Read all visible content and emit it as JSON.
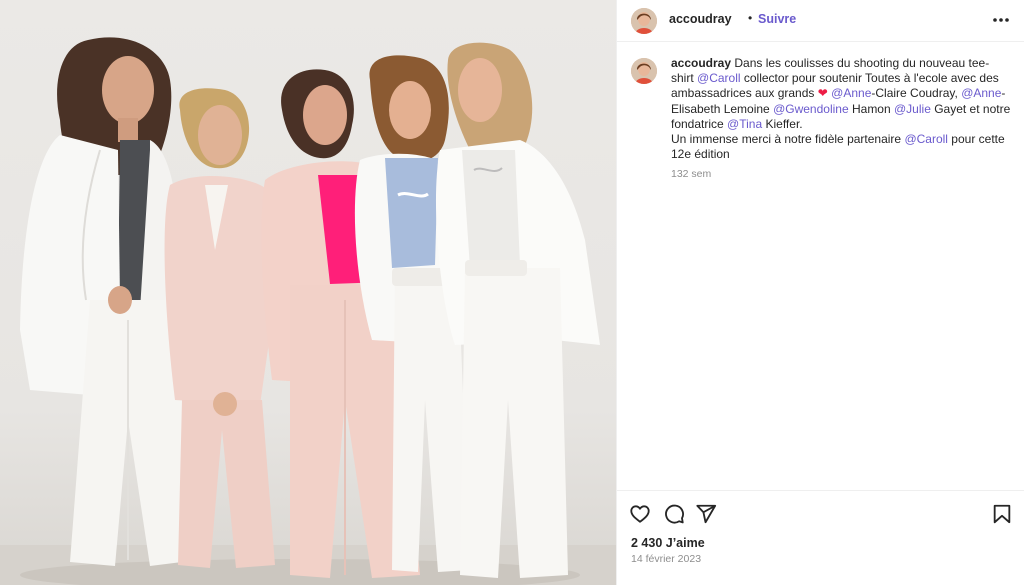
{
  "post": {
    "username": "accoudray",
    "separator": "•",
    "follow_label": "Suivre",
    "caption": {
      "username": "accoudray",
      "t1": " Dans les coulisses du shooting du nouveau tee-shirt ",
      "m1": "@Caroll",
      "t2": " collector pour soutenir Toutes à l'ecole avec des ambassadrices aux grands ",
      "heart": "❤",
      "t3": " ",
      "m2": "@Anne",
      "t4": "-Claire Coudray, ",
      "m3": "@Anne",
      "t5": "-Elisabeth Lemoine ",
      "m4": "@Gwendoline",
      "t6": " Hamon ",
      "m5": "@Julie",
      "t7": " Gayet et notre fondatrice ",
      "m6": "@Tina",
      "t8": " Kieffer.",
      "t9": "Un immense merci à notre fidèle partenaire ",
      "m7": "@Caroll",
      "t10": " pour cette 12e édition"
    },
    "age": "132 sem",
    "likes": "2 430 J’aime",
    "date": "14 février 2023"
  },
  "icons": {
    "more": "more-options-icon",
    "like": "heart-icon",
    "comment": "comment-icon",
    "share": "share-icon",
    "save": "bookmark-icon"
  },
  "colors": {
    "accent": "#6a5acd",
    "text": "#262626",
    "muted": "#8e8e8e",
    "heart": "#ed1c45",
    "border": "#efefef"
  }
}
